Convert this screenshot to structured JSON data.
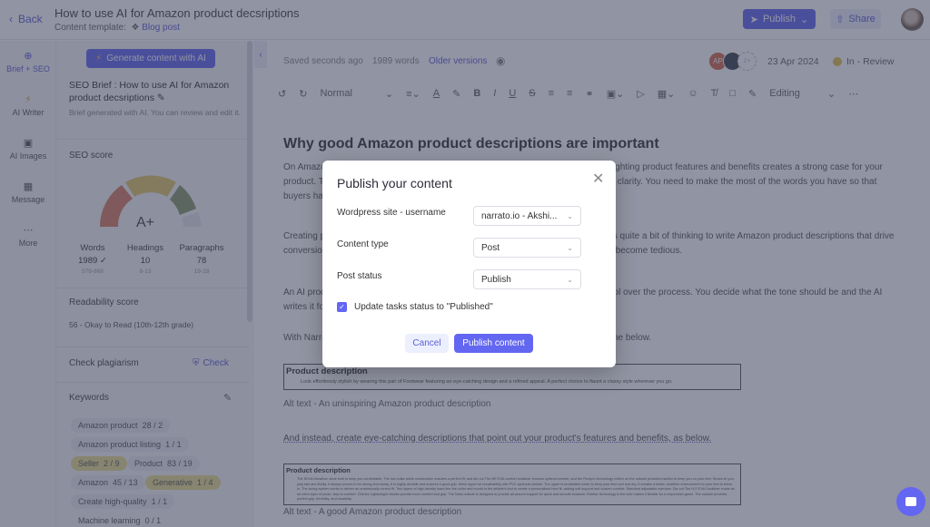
{
  "header": {
    "back_label": "Back",
    "title": "How to use AI for Amazon product decsriptions",
    "template_label": "Content template:",
    "template_value": "Blog post",
    "publish_label": "Publish",
    "share_label": "Share"
  },
  "rail": {
    "items": [
      {
        "label": "Brief + SEO",
        "icon": "crosshair-icon",
        "active": true
      },
      {
        "label": "AI Writer",
        "icon": "lightning-icon"
      },
      {
        "label": "AI Images",
        "icon": "image-icon"
      },
      {
        "label": "Message",
        "icon": "message-icon"
      },
      {
        "label": "More",
        "icon": "more-icon"
      }
    ]
  },
  "brief": {
    "generate_label": "Generate content with AI",
    "title": "SEO Brief : How to use AI for Amazon product decsriptions",
    "subtitle": "Brief generated with AI. You can review and edit it.",
    "seo_score_label": "SEO score",
    "grade": "A+",
    "stats": [
      {
        "label": "Words",
        "value": "1989",
        "range": "579-868",
        "check": true
      },
      {
        "label": "Headings",
        "value": "10",
        "range": "8-13"
      },
      {
        "label": "Paragraphs",
        "value": "78",
        "range": "19-28"
      }
    ],
    "readability_label": "Readability score",
    "readability_value": "56 - Okay to Read (10th-12th grade)",
    "plagiarism_label": "Check plagiarism",
    "plagiarism_action": "Check",
    "keywords_label": "Keywords",
    "keywords": [
      {
        "text": "Amazon product",
        "count": "28 / 2",
        "warn": false
      },
      {
        "text": "Amazon product listing",
        "count": "1 / 1",
        "warn": false
      },
      {
        "text": "Seller",
        "count": "2 / 9",
        "warn": true
      },
      {
        "text": "Product",
        "count": "83 / 19",
        "warn": false
      },
      {
        "text": "Amazon",
        "count": "45 / 13",
        "warn": false
      },
      {
        "text": "Generative",
        "count": "1 / 4",
        "warn": true
      },
      {
        "text": "Create high-quality",
        "count": "1 / 1",
        "warn": false
      },
      {
        "text": "Machine learning",
        "count": "0 / 1",
        "warn": false
      }
    ]
  },
  "editor": {
    "saved": "Saved seconds ago",
    "word_count": "1989 words",
    "older_versions": "Older versions",
    "avatar_initials": "AP",
    "avatar_more": "2+",
    "date": "23 Apr 2024",
    "status": "In - Review",
    "toolbar": {
      "style": "Normal",
      "mode": "Editing"
    },
    "heading": "Why good Amazon product descriptions are important",
    "paragraphs": [
      "On Amazon, your product description is what sells your product to shoppers. Highlighting product features and benefits creates a strong case for your product. The problem is not so much the quantity of information but the absence of clarity. You need to make the most of the words you have so that buyers have no doubt about what your product offers.",
      "Creating product descriptions is a cognitive task. We say cognitive because it takes quite a bit of thinking to write Amazon product descriptions that drive conversions. Composing descriptions for many products in the same category can become tedious.",
      "An AI product description generator creates interesting copy while giving you control over the process. You decide what the tone should be and the AI writes it for you in a matter of seconds.",
      "With Narrato AI content assistant, you can avoid uninspiring descriptions like the one below."
    ],
    "pd1_title": "Product description",
    "pd1_text": "Look effortlessly stylish by wearing this pair of Footwear featuring an eye-catching design and a refined appeal. A perfect choice to flaunt a classy style wherever you go.",
    "alt1": "Alt text - An uninspiring Amazon product description",
    "instead": "And instead, create eye-catching descriptions that point out your product's features and benefits, as below.",
    "pd2_title": "Product description",
    "pd2_text": "The NIVIA Marathon shoe built to keep you comfortable. The low collar ankle construction ensures a perfect fit, and die-cut The NR EVA comfort sockliner ensures optimal comfort, and the Flexipro technology rubber on the outsole provides traction to keep you on your feet. Shoes let you play fast and fluidly. It always proves to be strong and sturdy. It is highly durable and ensures a good grip. Mesh upper for breathability with PVC synthetic leather. The upper is breathable mesh to keep your feet cool and dry. It creates a better, healthier environment for your feet to thrive in. The lacing system works to deliver an anatomically correct fit. Two layers of high-density foam line the collar and mould to the athlete's foot to create a personalised heel fit, adding soft support and custom comfort. Standard adjustable eyerlace. Die-cut The N.R EVA Sockliner exists as an extra layer of plush, step-in comfort. Clothes Lightweight insoles provide more comfort and grip. The Nivia outsole is designed to provide all-around support for quick and smooth footwork. Rubber technology in the sole makes it flexible for a responsive game. The outsole provides perfect grip, flexibility, and durability.",
    "alt2": "Alt text - A good Amazon product description"
  },
  "modal": {
    "title": "Publish your content",
    "fields": [
      {
        "label": "Wordpress site - username",
        "value": "narrato.io - Akshi..."
      },
      {
        "label": "Content type",
        "value": "Post"
      },
      {
        "label": "Post status",
        "value": "Publish"
      }
    ],
    "checkbox_label": "Update tasks status to \"Published\"",
    "checkbox_checked": true,
    "cancel_label": "Cancel",
    "submit_label": "Publish content"
  },
  "colors": {
    "accent": "#6366f1",
    "overlay": "rgba(55,60,85,0.55)",
    "status_review": "#e0c24a",
    "avatar_ap": "#d3694f"
  }
}
